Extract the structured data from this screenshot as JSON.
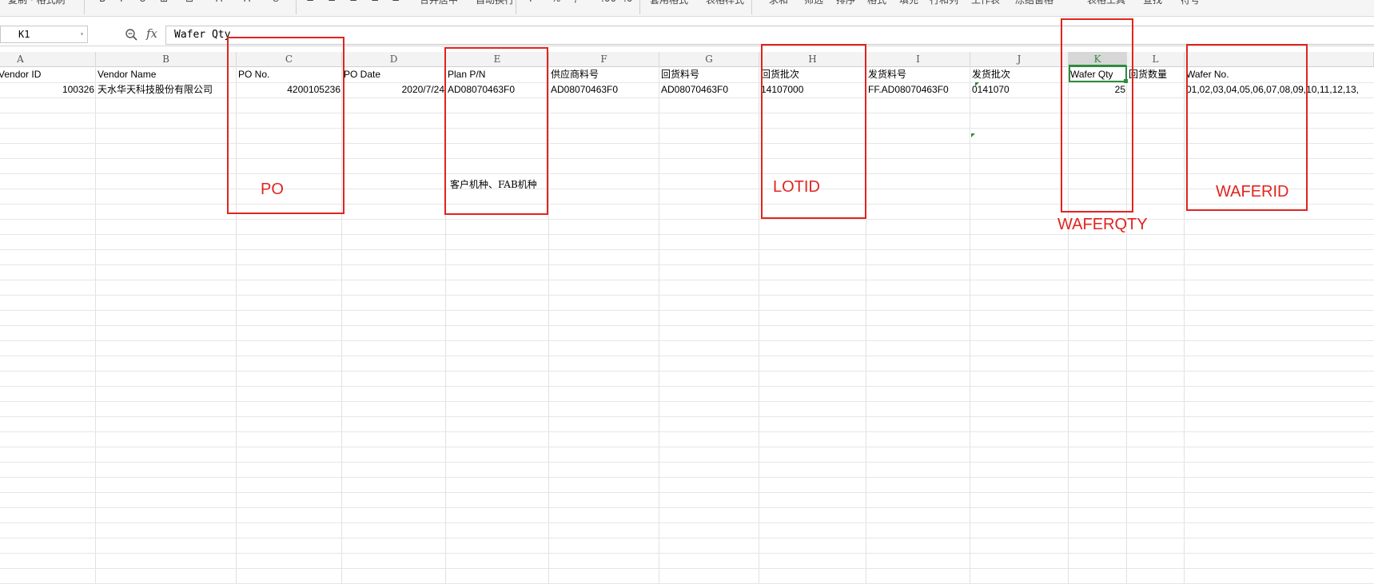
{
  "ribbon": {
    "items": [
      "复制 · 格式刷",
      "B",
      "I",
      "U",
      "⊞",
      "⊡",
      "A",
      "A",
      "⊘",
      "≡",
      "≡",
      "≡",
      "≡",
      "≡",
      "合并居中",
      "自动换行",
      "¥",
      "%",
      "‚",
      ".00",
      ".0",
      "套用格式",
      "表格样式",
      "求和",
      "筛选",
      "排序",
      "格式",
      "填充",
      "行和列",
      "工作表",
      "冻结窗格",
      "表格工具",
      "查找",
      "符号"
    ]
  },
  "formula_bar": {
    "name_box": "K1",
    "fx_label": "fx",
    "formula": "Wafer Qty"
  },
  "columns": [
    "A",
    "B",
    "C",
    "D",
    "E",
    "F",
    "G",
    "H",
    "I",
    "J",
    "K",
    "L",
    ""
  ],
  "active_column": "K",
  "rows": [
    [
      "Vendor ID",
      "Vendor Name",
      "PO No.",
      "PO Date",
      "Plan P/N",
      "供应商料号",
      "回货料号",
      "回货批次",
      "发货料号",
      "发货批次",
      "Wafer Qty",
      "回货数量",
      "Wafer No."
    ],
    [
      "100326",
      "天水华天科技股份有限公司",
      "4200105236",
      "2020/7/24",
      "AD08070463F0",
      "AD08070463F0",
      "AD08070463F0",
      "14107000",
      "FF.AD08070463F0",
      "0141070",
      "25",
      "",
      "01,02,03,04,05,06,07,08,09,10,11,12,13,"
    ]
  ],
  "annotations": [
    {
      "label": "PO"
    },
    {
      "label": "客户机种、FAB机种"
    },
    {
      "label": "LOTID"
    },
    {
      "label": "WAFERQTY"
    },
    {
      "label": "WAFERID"
    }
  ],
  "colors": {
    "annotation_red": "#e0241f",
    "active_green": "#2e8b3e",
    "grid_line": "#e2e2e2",
    "header_bg": "#f3f3f3"
  },
  "icons": {
    "zoom": "zoom-formula-icon",
    "dropdown": "chevron-down-icon"
  }
}
